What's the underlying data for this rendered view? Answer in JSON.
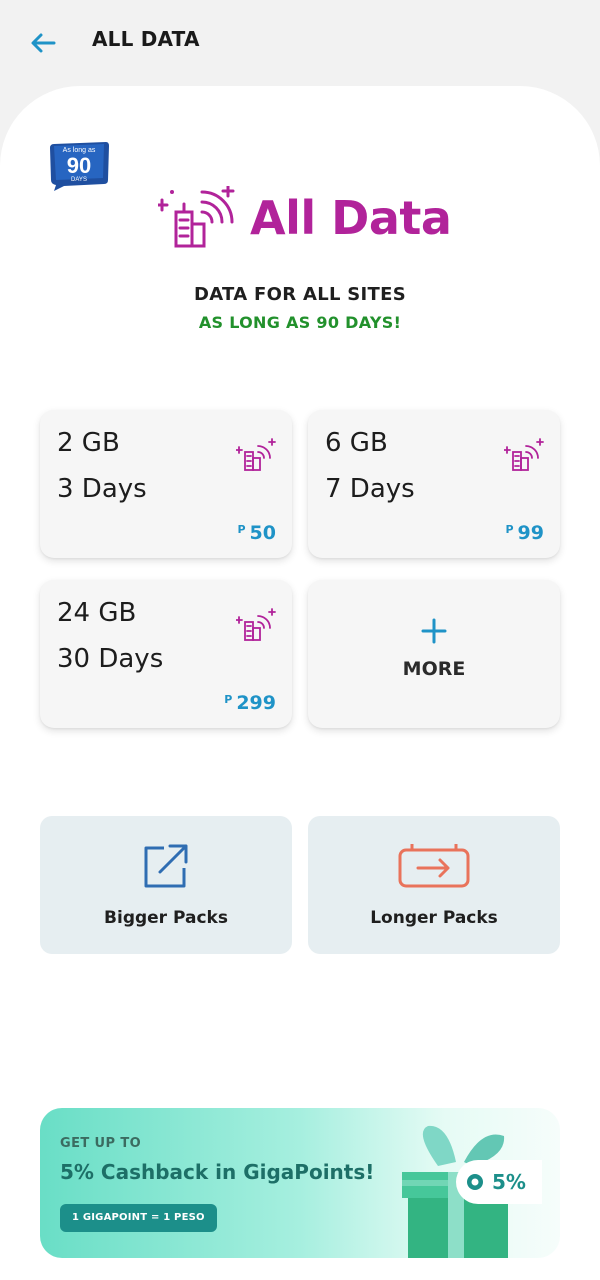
{
  "header": {
    "title": "ALL DATA",
    "back_icon": "arrow-left-icon"
  },
  "badge": {
    "line1": "As long as",
    "number": "90",
    "line2": "DAYS"
  },
  "brand": {
    "name": "All Data",
    "color": "#b1239a",
    "icon": "city-signal-icon"
  },
  "tagline": {
    "line1": "DATA FOR ALL SITES",
    "line2": "AS LONG AS 90 DAYS!"
  },
  "plans": [
    {
      "data": "2 GB",
      "validity": "3 Days",
      "currency": "P",
      "price": "50"
    },
    {
      "data": "6 GB",
      "validity": "7 Days",
      "currency": "P",
      "price": "99"
    },
    {
      "data": "24 GB",
      "validity": "30 Days",
      "currency": "P",
      "price": "299"
    }
  ],
  "more": {
    "icon": "plus-icon",
    "label": "MORE"
  },
  "packs": [
    {
      "label": "Bigger Packs",
      "icon": "external-link-icon"
    },
    {
      "label": "Longer Packs",
      "icon": "battery-arrow-icon"
    }
  ],
  "promo": {
    "kicker": "GET UP TO",
    "headline": "5% Cashback in GigaPoints!",
    "chip": "1 GIGAPOINT = 1 PESO",
    "percent": "5%"
  },
  "colors": {
    "accent": "#1f93c7",
    "green": "#22912c",
    "teal": "#1c8f8a"
  }
}
